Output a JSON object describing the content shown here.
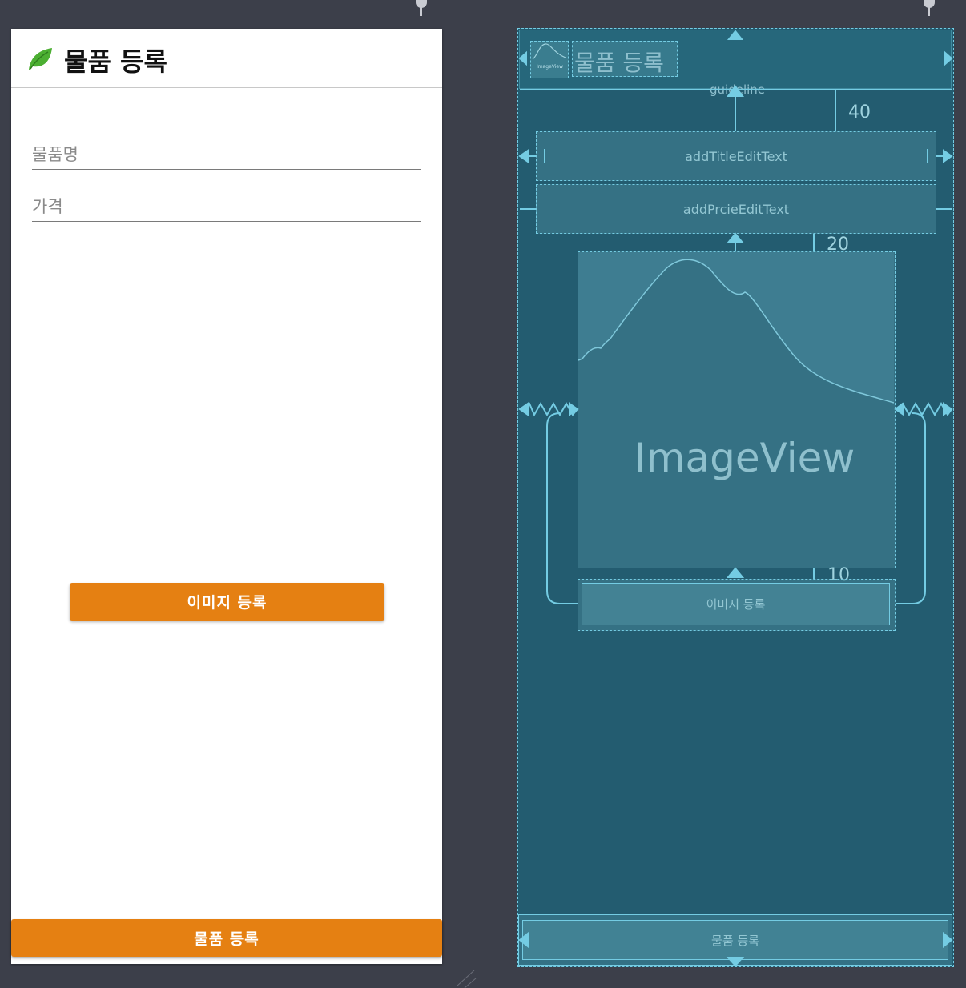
{
  "design": {
    "toolbar_title": "물품 등록",
    "title_hint": "물품명",
    "price_hint": "가격",
    "image_button": "이미지 등록",
    "submit_button": "물품 등록"
  },
  "blueprint": {
    "toolbar_image_label": "ImageView",
    "toolbar_title": "물품 등록",
    "guideline_label": "guideline",
    "margin_40": "40",
    "margin_20": "20",
    "margin_10": "10",
    "title_edit": "addTitleEditText",
    "price_edit": "addPrcieEditText",
    "image_view": "ImageView",
    "image_button": "이미지 등록",
    "submit_button": "물품 등록"
  },
  "colors": {
    "accent_orange": "#e58012",
    "leaf_green": "#4caf32",
    "blueprint_bg": "#235c70",
    "blueprint_line": "#74cce3",
    "canvas_bg": "#3c3f4a"
  }
}
